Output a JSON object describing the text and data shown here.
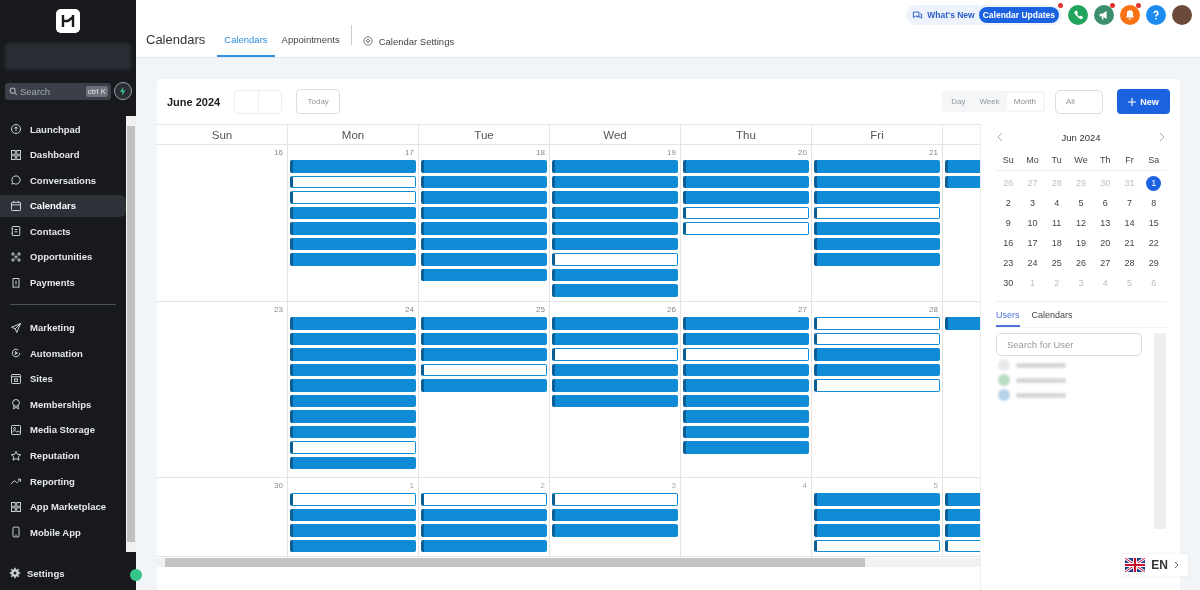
{
  "sidebar": {
    "search": {
      "placeholder": "Search",
      "shortcut": "ctrl K"
    },
    "groups": [
      [
        {
          "label": "Launchpad",
          "selected": false
        },
        {
          "label": "Dashboard",
          "selected": false
        },
        {
          "label": "Conversations",
          "selected": false
        },
        {
          "label": "Calendars",
          "selected": true
        },
        {
          "label": "Contacts",
          "selected": false
        },
        {
          "label": "Opportunities",
          "selected": false
        },
        {
          "label": "Payments",
          "selected": false
        }
      ],
      [
        {
          "label": "Marketing",
          "selected": false
        },
        {
          "label": "Automation",
          "selected": false
        },
        {
          "label": "Sites",
          "selected": false
        },
        {
          "label": "Memberships",
          "selected": false
        },
        {
          "label": "Media Storage",
          "selected": false
        },
        {
          "label": "Reputation",
          "selected": false
        },
        {
          "label": "Reporting",
          "selected": false
        },
        {
          "label": "App Marketplace",
          "selected": false
        },
        {
          "label": "Mobile App",
          "selected": false
        }
      ]
    ],
    "settings": "Settings"
  },
  "header": {
    "title": "Calendars",
    "tabs": [
      {
        "label": "Calendars",
        "selected": true
      },
      {
        "label": "Appointments",
        "selected": false
      }
    ],
    "settings_link": "Calendar Settings",
    "whats_new": "What's New",
    "updates_badge": "Calendar Updates",
    "actions": [
      {
        "color": "#22a45d",
        "notification": false
      },
      {
        "color": "#3b8f6a",
        "notification": true
      },
      {
        "color": "#f97316",
        "notification": true
      },
      {
        "color": "#1d8cf0",
        "notification": false
      }
    ]
  },
  "toolbar": {
    "month": "June 2024",
    "today": "Today",
    "views": [
      {
        "label": "Day",
        "selected": false
      },
      {
        "label": "Week",
        "selected": false
      },
      {
        "label": "Month",
        "selected": true
      }
    ],
    "filter": "All",
    "new_button": "New"
  },
  "calendar": {
    "weekdays": [
      "Sun",
      "Mon",
      "Tue",
      "Wed",
      "Thu",
      "Fri"
    ],
    "weeks": [
      {
        "days": [
          {
            "date": "16"
          },
          {
            "date": "17",
            "events": [
              {
                "outlined": false
              },
              {
                "outlined": true
              },
              {
                "outlined": true
              },
              {
                "outlined": false
              },
              {
                "outlined": false
              },
              {
                "outlined": false
              },
              {
                "outlined": false
              }
            ]
          },
          {
            "date": "18",
            "events": [
              {
                "outlined": false
              },
              {
                "outlined": false
              },
              {
                "outlined": false
              },
              {
                "outlined": false
              },
              {
                "outlined": false
              },
              {
                "outlined": false
              },
              {
                "outlined": false
              },
              {
                "outlined": false
              }
            ]
          },
          {
            "date": "19",
            "events": [
              {
                "outlined": false
              },
              {
                "outlined": false
              },
              {
                "outlined": false
              },
              {
                "outlined": false
              },
              {
                "outlined": false
              },
              {
                "outlined": false
              },
              {
                "outlined": true
              },
              {
                "outlined": false
              },
              {
                "outlined": false
              }
            ]
          },
          {
            "date": "20",
            "events": [
              {
                "outlined": false
              },
              {
                "outlined": false
              },
              {
                "outlined": false
              },
              {
                "outlined": true
              },
              {
                "outlined": true
              }
            ]
          },
          {
            "date": "21",
            "events": [
              {
                "outlined": false
              },
              {
                "outlined": false
              },
              {
                "outlined": false
              },
              {
                "outlined": true
              },
              {
                "outlined": false
              },
              {
                "outlined": false
              },
              {
                "outlined": false
              }
            ]
          },
          {
            "events": [
              {
                "outlined": false
              },
              {
                "outlined": false
              }
            ]
          }
        ]
      },
      {
        "days": [
          {
            "date": "23"
          },
          {
            "date": "24",
            "events": [
              {
                "outlined": false
              },
              {
                "outlined": false
              },
              {
                "outlined": false
              },
              {
                "outlined": false
              },
              {
                "outlined": false
              },
              {
                "outlined": false
              },
              {
                "outlined": false
              },
              {
                "outlined": false
              },
              {
                "outlined": true
              },
              {
                "outlined": false
              }
            ]
          },
          {
            "date": "25",
            "events": [
              {
                "outlined": false
              },
              {
                "outlined": false
              },
              {
                "outlined": false
              },
              {
                "outlined": true
              },
              {
                "outlined": false
              }
            ]
          },
          {
            "date": "26",
            "events": [
              {
                "outlined": false
              },
              {
                "outlined": false
              },
              {
                "outlined": true
              },
              {
                "outlined": false
              },
              {
                "outlined": false
              },
              {
                "outlined": false
              }
            ]
          },
          {
            "date": "27",
            "events": [
              {
                "outlined": false
              },
              {
                "outlined": false
              },
              {
                "outlined": true
              },
              {
                "outlined": false
              },
              {
                "outlined": false
              },
              {
                "outlined": false
              },
              {
                "outlined": false
              },
              {
                "outlined": false
              },
              {
                "outlined": false
              }
            ]
          },
          {
            "date": "28",
            "events": [
              {
                "outlined": true
              },
              {
                "outlined": true
              },
              {
                "outlined": false
              },
              {
                "outlined": false
              },
              {
                "outlined": true
              }
            ]
          },
          {
            "events": [
              {
                "outlined": false
              }
            ]
          }
        ]
      },
      {
        "days": [
          {
            "date": "30",
            "muted": false
          },
          {
            "date": "1",
            "muted": true,
            "events": [
              {
                "outlined": true
              },
              {
                "outlined": false
              },
              {
                "outlined": false
              },
              {
                "outlined": false
              }
            ]
          },
          {
            "date": "2",
            "muted": true,
            "events": [
              {
                "outlined": true
              },
              {
                "outlined": false
              },
              {
                "outlined": false
              },
              {
                "outlined": false
              }
            ]
          },
          {
            "date": "3",
            "muted": true,
            "events": [
              {
                "outlined": true
              },
              {
                "outlined": false
              },
              {
                "outlined": false
              }
            ]
          },
          {
            "date": "4",
            "muted": true
          },
          {
            "date": "5",
            "muted": true,
            "events": [
              {
                "outlined": false
              },
              {
                "outlined": false
              },
              {
                "outlined": false
              },
              {
                "outlined": true
              }
            ]
          },
          {
            "events": [
              {
                "outlined": false
              },
              {
                "outlined": false
              },
              {
                "outlined": false
              },
              {
                "outlined": true
              }
            ]
          }
        ]
      }
    ]
  },
  "mini_calendar": {
    "title": "Jun 2024",
    "weekdays": [
      "Su",
      "Mo",
      "Tu",
      "We",
      "Th",
      "Fr",
      "Sa"
    ],
    "weeks": [
      [
        {
          "d": "26",
          "muted": true,
          "selected": false
        },
        {
          "d": "27",
          "muted": true,
          "selected": false
        },
        {
          "d": "28",
          "muted": true,
          "selected": false
        },
        {
          "d": "29",
          "muted": true,
          "selected": false
        },
        {
          "d": "30",
          "muted": true,
          "selected": false
        },
        {
          "d": "31",
          "muted": true,
          "selected": false
        },
        {
          "d": "1",
          "muted": false,
          "selected": true
        }
      ],
      [
        {
          "d": "2",
          "muted": false,
          "selected": false
        },
        {
          "d": "3",
          "muted": false,
          "selected": false
        },
        {
          "d": "4",
          "muted": false,
          "selected": false
        },
        {
          "d": "5",
          "muted": false,
          "selected": false
        },
        {
          "d": "6",
          "muted": false,
          "selected": false
        },
        {
          "d": "7",
          "muted": false,
          "selected": false
        },
        {
          "d": "8",
          "muted": false,
          "selected": false
        }
      ],
      [
        {
          "d": "9",
          "muted": false,
          "selected": false
        },
        {
          "d": "10",
          "muted": false,
          "selected": false
        },
        {
          "d": "11",
          "muted": false,
          "selected": false
        },
        {
          "d": "12",
          "muted": false,
          "selected": false
        },
        {
          "d": "13",
          "muted": false,
          "selected": false
        },
        {
          "d": "14",
          "muted": false,
          "selected": false
        },
        {
          "d": "15",
          "muted": false,
          "selected": false
        }
      ],
      [
        {
          "d": "16",
          "muted": false,
          "selected": false
        },
        {
          "d": "17",
          "muted": false,
          "selected": false
        },
        {
          "d": "18",
          "muted": false,
          "selected": false
        },
        {
          "d": "19",
          "muted": false,
          "selected": false
        },
        {
          "d": "20",
          "muted": false,
          "selected": false
        },
        {
          "d": "21",
          "muted": false,
          "selected": false
        },
        {
          "d": "22",
          "muted": false,
          "selected": false
        }
      ],
      [
        {
          "d": "23",
          "muted": false,
          "selected": false
        },
        {
          "d": "24",
          "muted": false,
          "selected": false
        },
        {
          "d": "25",
          "muted": false,
          "selected": false
        },
        {
          "d": "26",
          "muted": false,
          "selected": false
        },
        {
          "d": "27",
          "muted": false,
          "selected": false
        },
        {
          "d": "28",
          "muted": false,
          "selected": false
        },
        {
          "d": "29",
          "muted": false,
          "selected": false
        }
      ],
      [
        {
          "d": "30",
          "muted": false,
          "selected": false
        },
        {
          "d": "1",
          "muted": true,
          "selected": false
        },
        {
          "d": "2",
          "muted": true,
          "selected": false
        },
        {
          "d": "3",
          "muted": true,
          "selected": false
        },
        {
          "d": "4",
          "muted": true,
          "selected": false
        },
        {
          "d": "5",
          "muted": true,
          "selected": false
        },
        {
          "d": "6",
          "muted": true,
          "selected": false
        }
      ]
    ]
  },
  "people_panel": {
    "tabs": [
      {
        "label": "Users",
        "selected": true
      },
      {
        "label": "Calendars",
        "selected": false
      }
    ],
    "search_placeholder": "Search for User",
    "users": [
      {
        "color": "#e8e8e8"
      },
      {
        "color": "#b9dcc4"
      },
      {
        "color": "#b6d3ea"
      }
    ]
  },
  "language": "EN"
}
